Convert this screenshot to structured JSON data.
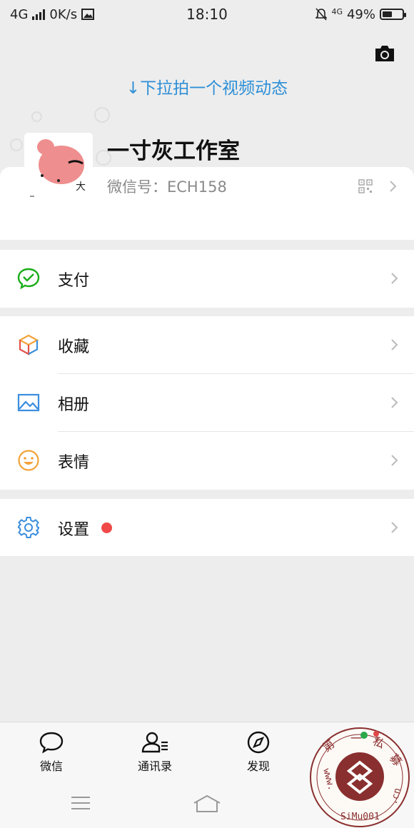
{
  "status_bar": {
    "network": "4G",
    "speed": "0K/s",
    "time": "18:10",
    "network_right": "4G",
    "battery": "49%",
    "battery_level": 0.49
  },
  "header": {
    "pull_hint": "↓下拉拍一个视频动态"
  },
  "profile": {
    "nickname": "一寸灰工作室",
    "wechat_id": "微信号：ECH158"
  },
  "menu": {
    "pay": "支付",
    "favorites": "收藏",
    "album": "相册",
    "stickers": "表情",
    "settings": "设置"
  },
  "tabs": {
    "chats": "微信",
    "contacts": "通讯录",
    "discover": "发现"
  },
  "watermark": {
    "text_top": "第一私募",
    "url": "www.SiMu001.cn"
  },
  "colors": {
    "accent_blue": "#2e8fd6",
    "pay_green": "#1aad19",
    "badge_red": "#f04848"
  }
}
